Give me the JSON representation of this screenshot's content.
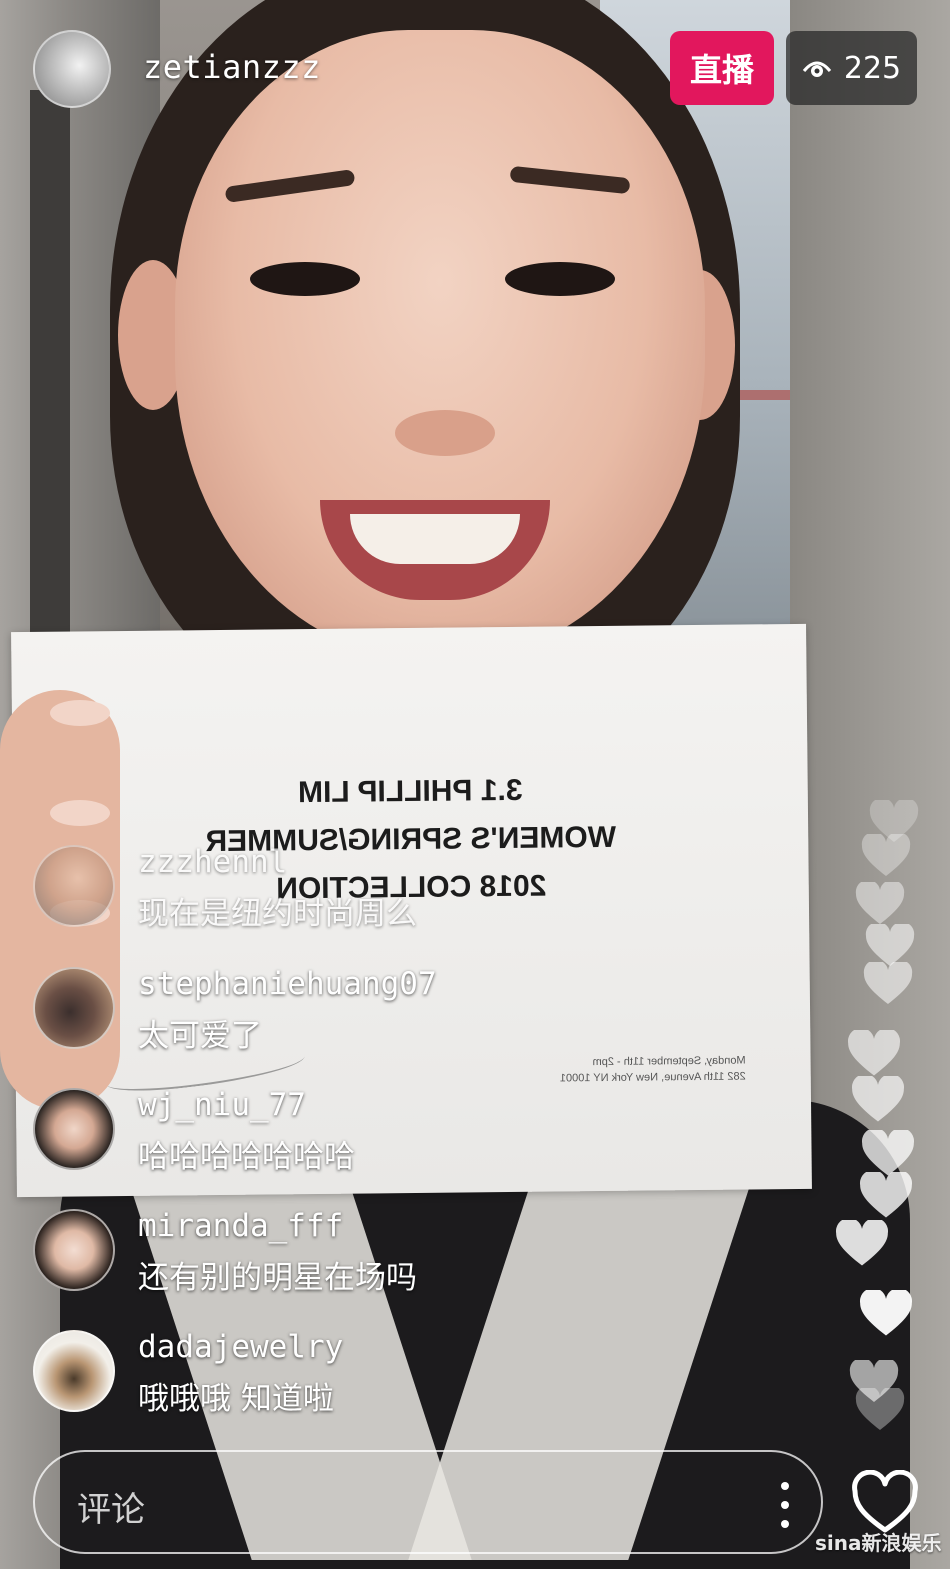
{
  "host": {
    "username": "zetianzzz",
    "live_label": "直播",
    "viewer_count": "225",
    "live_color": "#e2175d"
  },
  "card": {
    "lines": [
      "3.1 PHILLIP LIM",
      "WOMEN'S SPRING/SUMMER",
      "2018 COLLECTION"
    ],
    "details": [
      "Monday, September 11th - 2pm",
      "282 11th Avenue, New York NY 10001"
    ]
  },
  "comments": [
    {
      "username": "zzzhennl",
      "text": "现在是纽约时尚周么"
    },
    {
      "username": "stephaniehuang07",
      "text": "太可爱了"
    },
    {
      "username": "wj_niu_77",
      "text": "哈哈哈哈哈哈哈"
    },
    {
      "username": "miranda_fff",
      "text": "还有别的明星在场吗"
    },
    {
      "username": "dadajewelry",
      "text": "哦哦哦 知道啦"
    }
  ],
  "comment_input": {
    "placeholder": "评论"
  },
  "watermark": "sina新浪娱乐",
  "icons": {
    "viewers": "eye-icon",
    "more": "more-vertical-icon",
    "like": "heart-outline-icon",
    "reaction": "heart-icon"
  }
}
